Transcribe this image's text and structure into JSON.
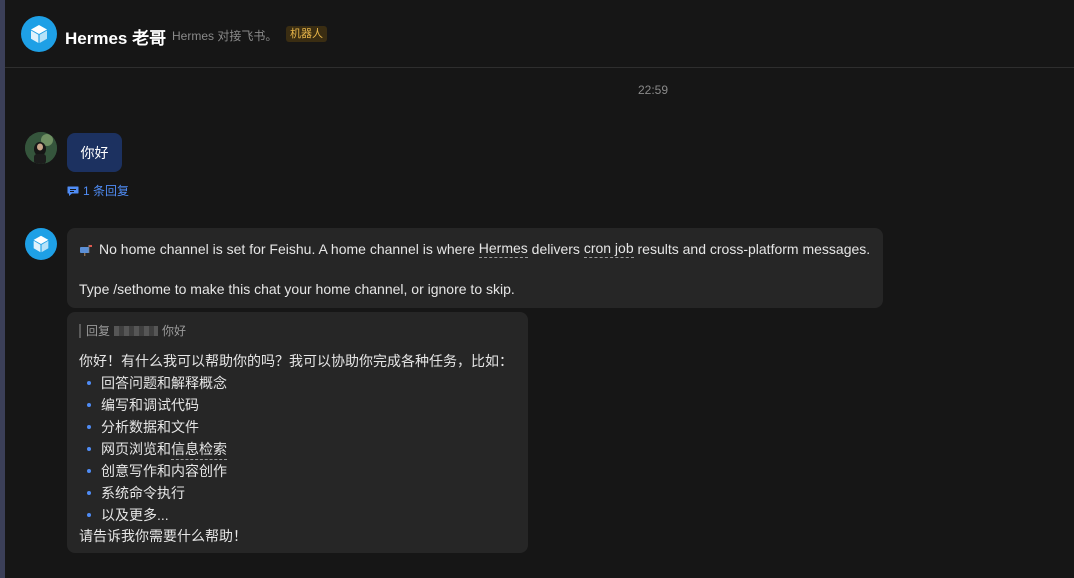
{
  "header": {
    "title": "Hermes 老哥",
    "description": "Hermes 对接飞书。",
    "badge": "机器人"
  },
  "chat": {
    "timestamp": "22:59",
    "user_message": {
      "text": "你好",
      "reply_count_label": "1 条回复"
    },
    "bot_message_1": {
      "line1_pre": "No home channel is set for Feishu. A home channel is where ",
      "line1_link1": "Hermes",
      "line1_mid": " delivers ",
      "line1_link2": "cron job",
      "line1_post": " results and cross-platform messages.",
      "line2": "Type /sethome to make this chat your home channel, or ignore to skip."
    },
    "bot_message_2": {
      "quote_prefix": "回复",
      "quote_text": "你好",
      "intro": "你好！有什么我可以帮助你的吗？我可以协助你完成各种任务，比如：",
      "items": [
        "回答问题和解释概念",
        "编写和调试代码",
        "分析数据和文件",
        "网页浏览和信息检索",
        "创意写作和内容创作",
        "系统命令执行",
        "以及更多..."
      ],
      "item4_pre": "网页浏览和",
      "item4_link": "信息检索",
      "outro": "请告诉我你需要什么帮助！"
    }
  },
  "colors": {
    "background": "#161616",
    "bubble": "#262626",
    "user_bubble": "#1c3160",
    "accent": "#4f8cf5",
    "bot_avatar": "#1ea0e6",
    "badge_text": "#e8b64a"
  }
}
